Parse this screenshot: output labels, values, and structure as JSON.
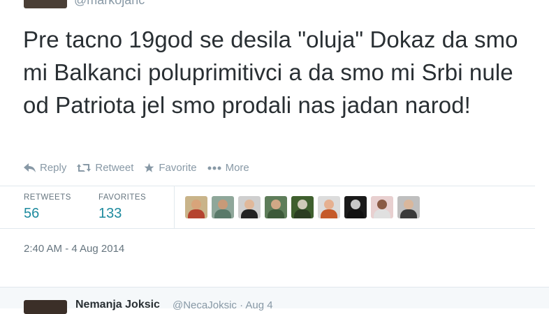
{
  "top": {
    "handle": "@markojaric"
  },
  "tweet": {
    "text": "Pre tacno 19god se desila \"oluja\" Dokaz da smo mi Balkanci poluprimitivci a da smo mi Srbi nule od Patriota jel smo prodali nas jadan narod!"
  },
  "actions": [
    {
      "label": "Reply",
      "icon": "reply-icon"
    },
    {
      "label": "Retweet",
      "icon": "retweet-icon"
    },
    {
      "label": "Favorite",
      "icon": "star-icon"
    },
    {
      "label": "More",
      "icon": "more-dots-icon"
    }
  ],
  "stats": {
    "retweets_label": "RETWEETS",
    "retweets_count": "56",
    "favorites_label": "FAVORITES",
    "favorites_count": "133"
  },
  "favoriters": [
    {
      "bg": "#c9b48a",
      "skin": "#d8a47a",
      "shirt": "#b5432f"
    },
    {
      "bg": "#8fa79a",
      "skin": "#c89a78",
      "shirt": "#5a7a6a"
    },
    {
      "bg": "#cfcfcf",
      "skin": "#e0b89a",
      "shirt": "#222222"
    },
    {
      "bg": "#5e7d5a",
      "skin": "#d1a886",
      "shirt": "#3d5a3a"
    },
    {
      "bg": "#3f5f2e",
      "skin": "#cfc9b8",
      "shirt": "#2b3d22"
    },
    {
      "bg": "#dcdcdc",
      "skin": "#e6b090",
      "shirt": "#c55a2a"
    },
    {
      "bg": "#1a1a1a",
      "skin": "#c8c8c8",
      "shirt": "#111111"
    },
    {
      "bg": "#e8d0d0",
      "skin": "#8a5a44",
      "shirt": "#e0e0e0"
    },
    {
      "bg": "#bfbfbf",
      "skin": "#d9b79c",
      "shirt": "#3a3a3a"
    }
  ],
  "timestamp": "2:40 AM - 4 Aug 2014",
  "reply": {
    "name": "Nemanja Joksic",
    "meta": "@NecaJoksic · Aug 4"
  },
  "colors": {
    "accent": "#1d8a9e",
    "muted": "#8899a6",
    "text": "#292f33"
  }
}
